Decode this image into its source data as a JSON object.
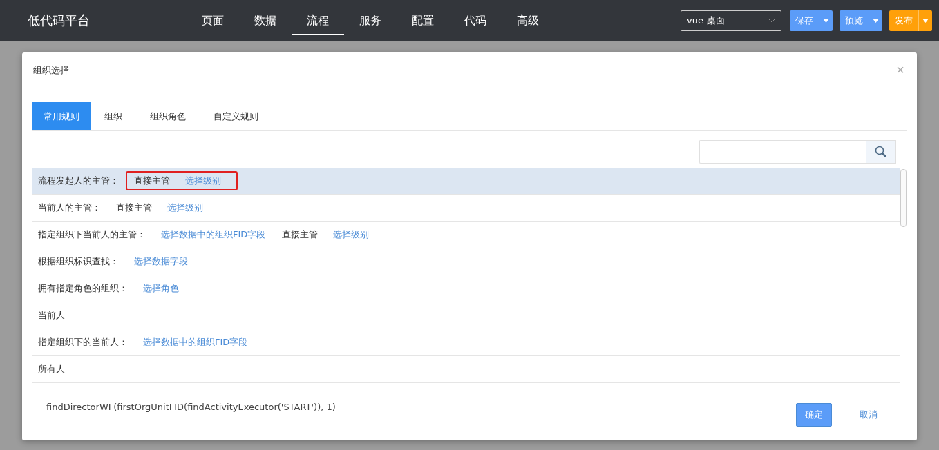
{
  "app": {
    "title": "低代码平台"
  },
  "nav": [
    {
      "label": "页面",
      "selected": false
    },
    {
      "label": "数据",
      "selected": false
    },
    {
      "label": "流程",
      "selected": true
    },
    {
      "label": "服务",
      "selected": false
    },
    {
      "label": "配置",
      "selected": false
    },
    {
      "label": "代码",
      "selected": false
    },
    {
      "label": "高级",
      "selected": false
    }
  ],
  "platform_select": {
    "value": "vue-桌面"
  },
  "actions": [
    {
      "label": "保存",
      "kind": "primary"
    },
    {
      "label": "预览",
      "kind": "primary"
    },
    {
      "label": "发布",
      "kind": "warning"
    }
  ],
  "dialog": {
    "title": "组织选择",
    "close": "×",
    "tabs": [
      {
        "label": "常用规则",
        "selected": true
      },
      {
        "label": "组织",
        "selected": false
      },
      {
        "label": "组织角色",
        "selected": false
      },
      {
        "label": "自定义规则",
        "selected": false
      }
    ],
    "rows": [
      {
        "label": "流程发起人的主管：",
        "selected": true,
        "outlined": true,
        "parts": [
          {
            "kind": "text",
            "text": "直接主管"
          },
          {
            "kind": "link",
            "text": "选择级别"
          }
        ]
      },
      {
        "label": "当前人的主管：",
        "selected": false,
        "outlined": false,
        "parts": [
          {
            "kind": "text",
            "text": "直接主管"
          },
          {
            "kind": "link",
            "text": "选择级别"
          }
        ]
      },
      {
        "label": "指定组织下当前人的主管：",
        "selected": false,
        "outlined": false,
        "parts": [
          {
            "kind": "link",
            "text": "选择数据中的组织FID字段"
          },
          {
            "kind": "text",
            "text": "直接主管"
          },
          {
            "kind": "link",
            "text": "选择级别"
          }
        ]
      },
      {
        "label": "根据组织标识查找：",
        "selected": false,
        "outlined": false,
        "parts": [
          {
            "kind": "link",
            "text": "选择数据字段"
          }
        ]
      },
      {
        "label": "拥有指定角色的组织：",
        "selected": false,
        "outlined": false,
        "parts": [
          {
            "kind": "link",
            "text": "选择角色"
          }
        ]
      },
      {
        "label": "当前人",
        "selected": false,
        "outlined": false,
        "parts": []
      },
      {
        "label": "指定组织下的当前人：",
        "selected": false,
        "outlined": false,
        "parts": [
          {
            "kind": "link",
            "text": "选择数据中的组织FID字段"
          }
        ]
      },
      {
        "label": "所有人",
        "selected": false,
        "outlined": false,
        "parts": []
      }
    ],
    "expression": "findDirectorWF(firstOrgUnitFID(findActivityExecutor('START')), 1)",
    "buttons": [
      {
        "label": "确定",
        "kind": "primary"
      },
      {
        "label": "取消",
        "kind": "link"
      }
    ]
  }
}
